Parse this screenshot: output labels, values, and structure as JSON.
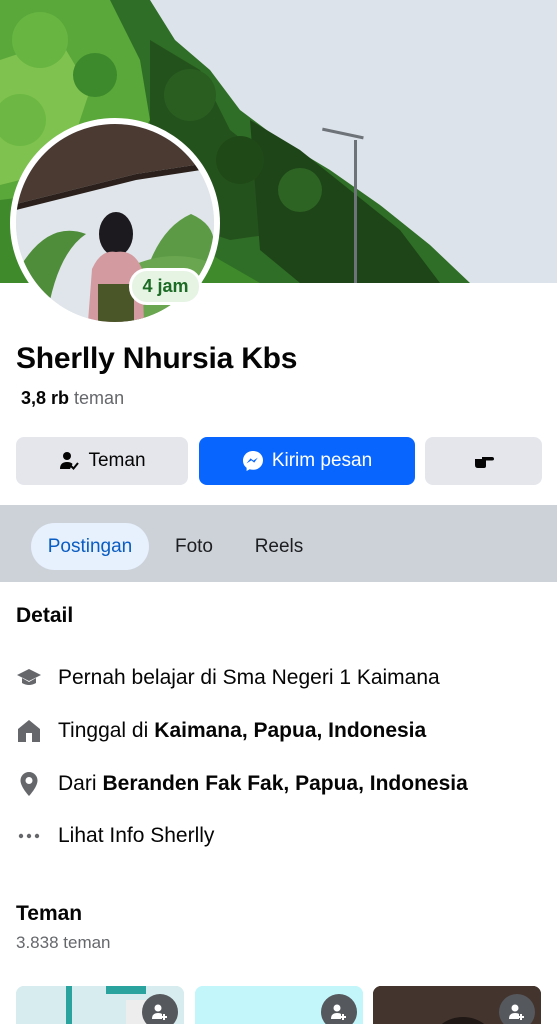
{
  "profile": {
    "name": "Sherlly Nhursia Kbs",
    "story_time": "4 jam",
    "friends_count_bold": "3,8 rb",
    "friends_count_label": "teman"
  },
  "actions": {
    "friends_label": "Teman",
    "message_label": "Kirim pesan",
    "icons": [
      "person-check-icon",
      "messenger-icon",
      "pointing-hand-icon"
    ]
  },
  "tabs": [
    {
      "label": "Postingan",
      "active": true
    },
    {
      "label": "Foto",
      "active": false
    },
    {
      "label": "Reels",
      "active": false
    }
  ],
  "detail": {
    "title": "Detail",
    "items": [
      {
        "icon": "graduation-cap-icon",
        "prefix": "Pernah belajar di Sma Negeri 1 Kaimana",
        "bold": ""
      },
      {
        "icon": "home-icon",
        "prefix": "Tinggal di",
        "bold": "Kaimana, Papua, Indonesia"
      },
      {
        "icon": "location-pin-icon",
        "prefix": "Dari",
        "bold": "Beranden Fak Fak, Papua, Indonesia"
      },
      {
        "icon": "more-dots-icon",
        "prefix": "Lihat Info Sherlly",
        "bold": ""
      }
    ]
  },
  "friends_section": {
    "title": "Teman",
    "count_label": "3.838 teman"
  },
  "colors": {
    "primary": "#0866ff",
    "button_gray": "#e4e6eb",
    "tab_bar": "#cdd2d8",
    "active_tab_text": "#0a5dc2",
    "secondary_text": "#65676b",
    "story_badge_bg": "#e6f4e4",
    "story_badge_text": "#1c6b24"
  }
}
